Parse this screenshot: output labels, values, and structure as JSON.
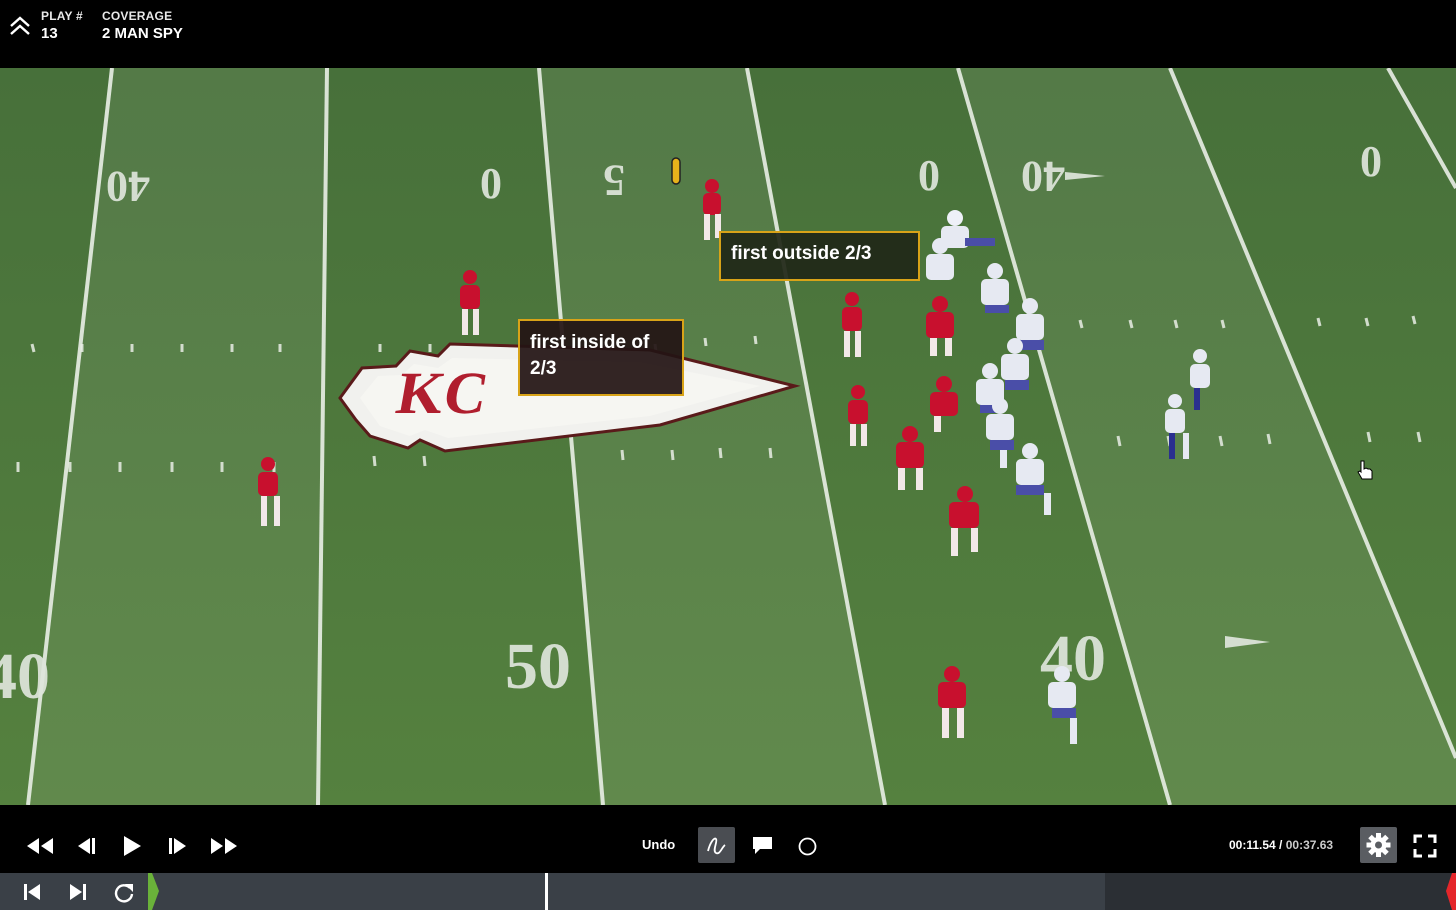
{
  "header": {
    "collapse_icon": "chevron-double-up-icon",
    "play_label": "PLAY #",
    "play_value": "13",
    "coverage_label": "COVERAGE",
    "coverage_value": "2 MAN SPY"
  },
  "annotations": [
    {
      "text": "first outside 2/3"
    },
    {
      "text": "first inside of 2/3"
    }
  ],
  "field": {
    "numbers": {
      "far_left": "40",
      "far_50": "50",
      "far_right": "40",
      "near_left": "40",
      "near_50": "50",
      "near_right": "40"
    },
    "turf_color": "#4f7a3d",
    "chiefs_color": "#c8102e",
    "bills_color": "#e6e9f2"
  },
  "controls": {
    "rewind_icon": "rewind-icon",
    "step_back_icon": "step-back-icon",
    "play_icon": "play-icon",
    "step_forward_icon": "step-forward-icon",
    "fast_forward_icon": "fast-forward-icon",
    "undo_label": "Undo",
    "draw_icon": "freehand-draw-icon",
    "comment_icon": "comment-icon",
    "circle_icon": "circle-tool-icon",
    "current_time": "00:11.54",
    "separator": " / ",
    "total_time": "00:37.63",
    "settings_icon": "gear-icon",
    "fullscreen_icon": "fullscreen-icon"
  },
  "timeline": {
    "skip_start_icon": "skip-to-start-icon",
    "skip_end_icon": "skip-to-end-icon",
    "replay_icon": "replay-icon",
    "progress": 0.307,
    "accent": "#6ab23a",
    "marker_color": "#e4262a"
  }
}
